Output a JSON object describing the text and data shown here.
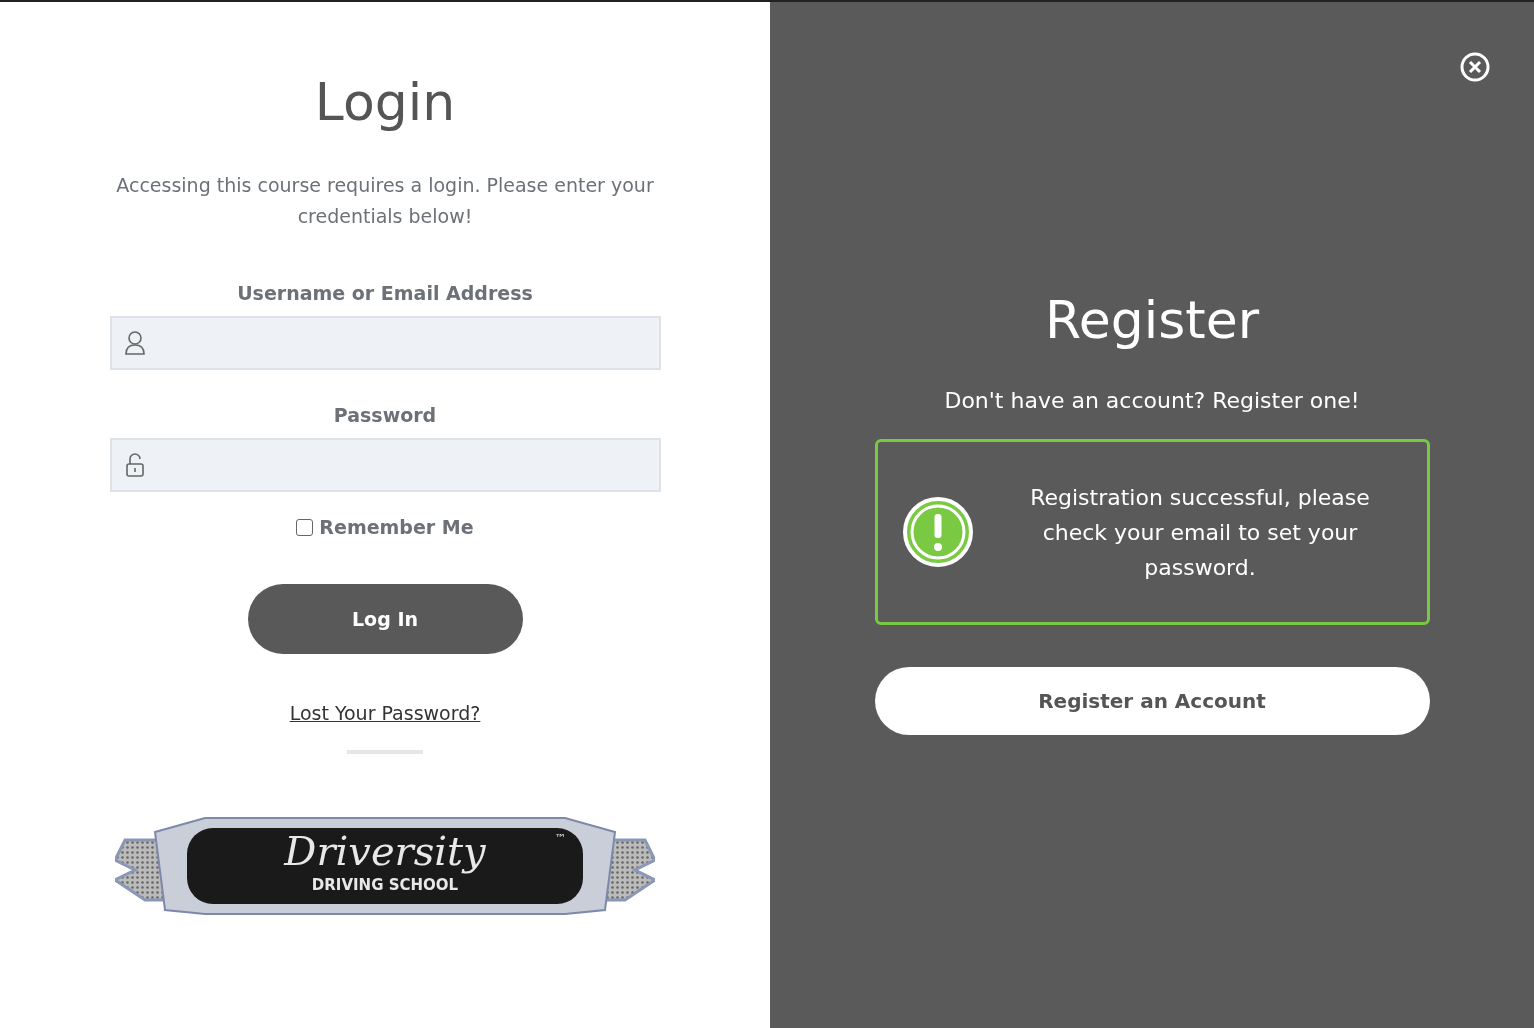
{
  "login": {
    "title": "Login",
    "intro": "Accessing this course requires a login. Please enter your credentials below!",
    "fields": [
      {
        "label": "Username or Email Address",
        "kind": "user"
      },
      {
        "label": "Password",
        "kind": "password"
      }
    ],
    "remember": {
      "label": "Remember Me",
      "checked": false
    },
    "submit": "Log In",
    "lost_password": "Lost Your Password?",
    "logo": {
      "name": "Driversity",
      "trademark": "™",
      "tagline": "DRIVING SCHOOL"
    }
  },
  "register": {
    "title": "Register",
    "subtitle": "Don't have an account? Register one!",
    "notice": "Registration successful, please check your email to set your password.",
    "button": "Register an Account"
  }
}
